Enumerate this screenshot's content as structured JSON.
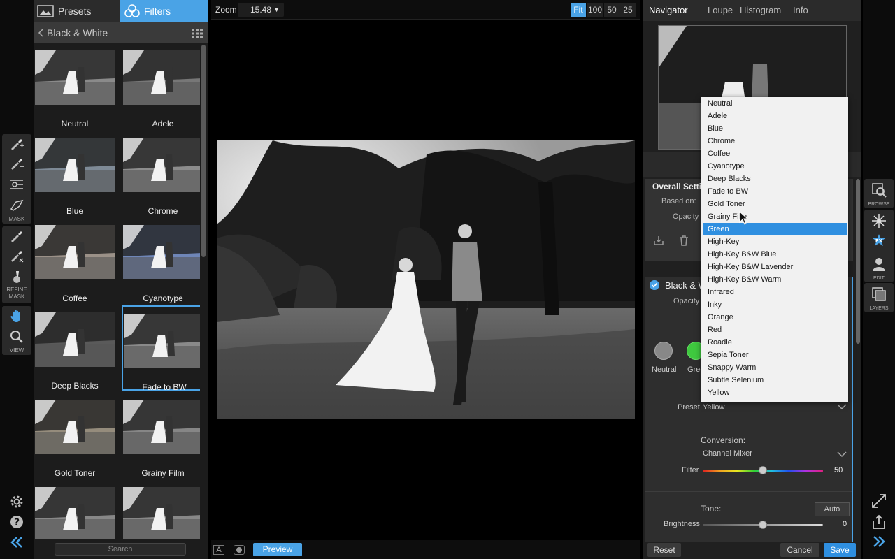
{
  "tools": {
    "mask_caption": "MASK",
    "refine_caption_line1": "REFINE",
    "refine_caption_line2": "MASK",
    "view_caption": "VIEW"
  },
  "panel": {
    "tab_presets": "Presets",
    "tab_filters": "Filters",
    "category": "Black & White",
    "search_placeholder": "Search",
    "thumbnails": [
      {
        "label": "Neutral"
      },
      {
        "label": "Adele"
      },
      {
        "label": "Blue"
      },
      {
        "label": "Chrome"
      },
      {
        "label": "Coffee"
      },
      {
        "label": "Cyanotype"
      },
      {
        "label": "Deep Blacks"
      },
      {
        "label": "Fade to BW"
      },
      {
        "label": "Gold Toner"
      },
      {
        "label": "Grainy Film"
      },
      {
        "label": ""
      },
      {
        "label": ""
      }
    ]
  },
  "topbar": {
    "zoom_label": "Zoom",
    "zoom_value": "15.48",
    "zoom_fit": "Fit",
    "zoom_100": "100",
    "zoom_50": "50",
    "zoom_25": "25"
  },
  "bottombar": {
    "mode_a": "A",
    "preview": "Preview"
  },
  "right": {
    "tabs": {
      "navigator": "Navigator",
      "loupe": "Loupe",
      "histogram": "Histogram",
      "info": "Info"
    },
    "overall": {
      "title": "Overall Setti",
      "based_on": "Based on:",
      "opacity": "Opacity"
    },
    "bw": {
      "title": "Black & W",
      "opacity": "Opacity",
      "swatch_neutral": "Neutral",
      "swatch_green": "Green",
      "preset_label": "Preset",
      "preset_value": "Yellow",
      "conversion_label": "Conversion:",
      "conversion_value": "Channel Mixer",
      "filter_label": "Filter",
      "filter_value": "50",
      "filter_level": 50,
      "tone_label": "Tone:",
      "auto": "Auto",
      "brightness_label": "Brightness",
      "brightness_value": "0",
      "brightness_level": 0
    },
    "footer": {
      "reset": "Reset",
      "cancel": "Cancel",
      "save": "Save"
    }
  },
  "dropdown": {
    "items": [
      "Neutral",
      "Adele",
      "Blue",
      "Chrome",
      "Coffee",
      "Cyanotype",
      "Deep Blacks",
      "Fade to BW",
      "Gold Toner",
      "Grainy Film",
      "Green",
      "High-Key",
      "High-Key B&W Blue",
      "High-Key B&W Lavender",
      "High-Key B&W Warm",
      "Infrared",
      "Inky",
      "Orange",
      "Red",
      "Roadie",
      "Sepia Toner",
      "Snappy Warm",
      "Subtle Selenium",
      "Yellow"
    ],
    "highlighted": "Green"
  },
  "modules": {
    "browse": "BROWSE",
    "fx": "",
    "edit": "EDIT",
    "layers": "LAYERS"
  },
  "colors": {
    "accent": "#4aa3e6",
    "highlight": "#2f8fe0"
  }
}
